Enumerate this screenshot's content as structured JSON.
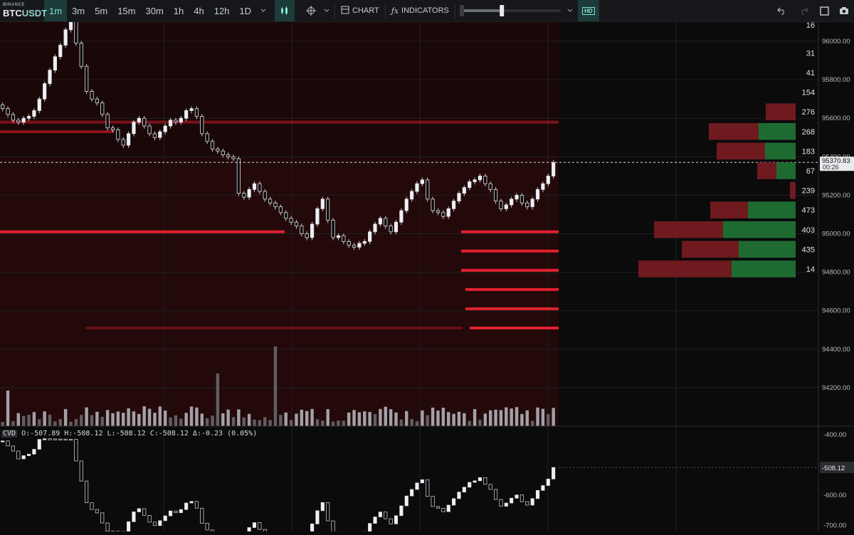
{
  "toolbar": {
    "exchange": "BINANCE",
    "symbol_base": "BTC",
    "symbol_quote": "USDT",
    "timeframes": [
      "1m",
      "3m",
      "5m",
      "15m",
      "30m",
      "1h",
      "4h",
      "12h",
      "1D"
    ],
    "active_timeframe": "1m",
    "chart_label": "CHART",
    "indicators_label": "INDICATORS",
    "hd_label": "HD",
    "icons": [
      "candles-icon",
      "crosshair-icon",
      "chevron-down-icon",
      "chart-icon",
      "fx-icon",
      "slider-icon",
      "undo-icon",
      "redo-icon",
      "square-icon",
      "camera-icon"
    ],
    "slider_level": 0.4
  },
  "price_axis": {
    "labels": [
      "96000.00",
      "95800.00",
      "95600.00",
      "95400.00",
      "95200.00",
      "95000.00",
      "94800.00",
      "94600.00",
      "94400.00",
      "94200.00"
    ],
    "current_price": "95370.83",
    "countdown": "00:26"
  },
  "heatmap_counts": [
    "16",
    "31",
    "41",
    "154",
    "276",
    "268",
    "183",
    "67",
    "239",
    "473",
    "403",
    "435",
    "14"
  ],
  "cvd": {
    "name": "CVD",
    "legend": "O:-507.89 H:-508.12 L:-508.12 C:-508.12 Δ:-0.23 (0.05%)",
    "axis_labels": [
      "-400.00",
      "-500.00",
      "-600.00",
      "-700.00"
    ],
    "current": "-508.12"
  },
  "colors": {
    "accent": "#7ee3d0",
    "bid": "#1e6b32",
    "ask": "#6e1a1f",
    "level": "#e0202c",
    "candle": "#e6e8ee"
  },
  "chart_data": {
    "type": "candlestick",
    "y_range": [
      94000,
      96100
    ],
    "close_series": [
      95650,
      95620,
      95590,
      95580,
      95600,
      95610,
      95640,
      95700,
      95780,
      95850,
      95920,
      95980,
      96060,
      96120,
      95990,
      95870,
      95740,
      95700,
      95680,
      95620,
      95550,
      95540,
      95490,
      95460,
      95520,
      95580,
      95600,
      95560,
      95520,
      95500,
      95530,
      95560,
      95590,
      95580,
      95600,
      95640,
      95650,
      95610,
      95520,
      95480,
      95440,
      95430,
      95410,
      95400,
      95390,
      95210,
      95190,
      95230,
      95260,
      95220,
      95180,
      95160,
      95140,
      95110,
      95080,
      95060,
      95040,
      95000,
      94980,
      95050,
      95130,
      95180,
      95070,
      94980,
      94990,
      94960,
      94940,
      94930,
      94950,
      94960,
      95010,
      95050,
      95080,
      95040,
      95010,
      95060,
      95120,
      95180,
      95220,
      95260,
      95280,
      95180,
      95120,
      95110,
      95090,
      95130,
      95170,
      95210,
      95240,
      95270,
      95280,
      95300,
      95260,
      95230,
      95170,
      95130,
      95150,
      95180,
      95200,
      95160,
      95140,
      95180,
      95230,
      95260,
      95300,
      95370
    ]
  }
}
